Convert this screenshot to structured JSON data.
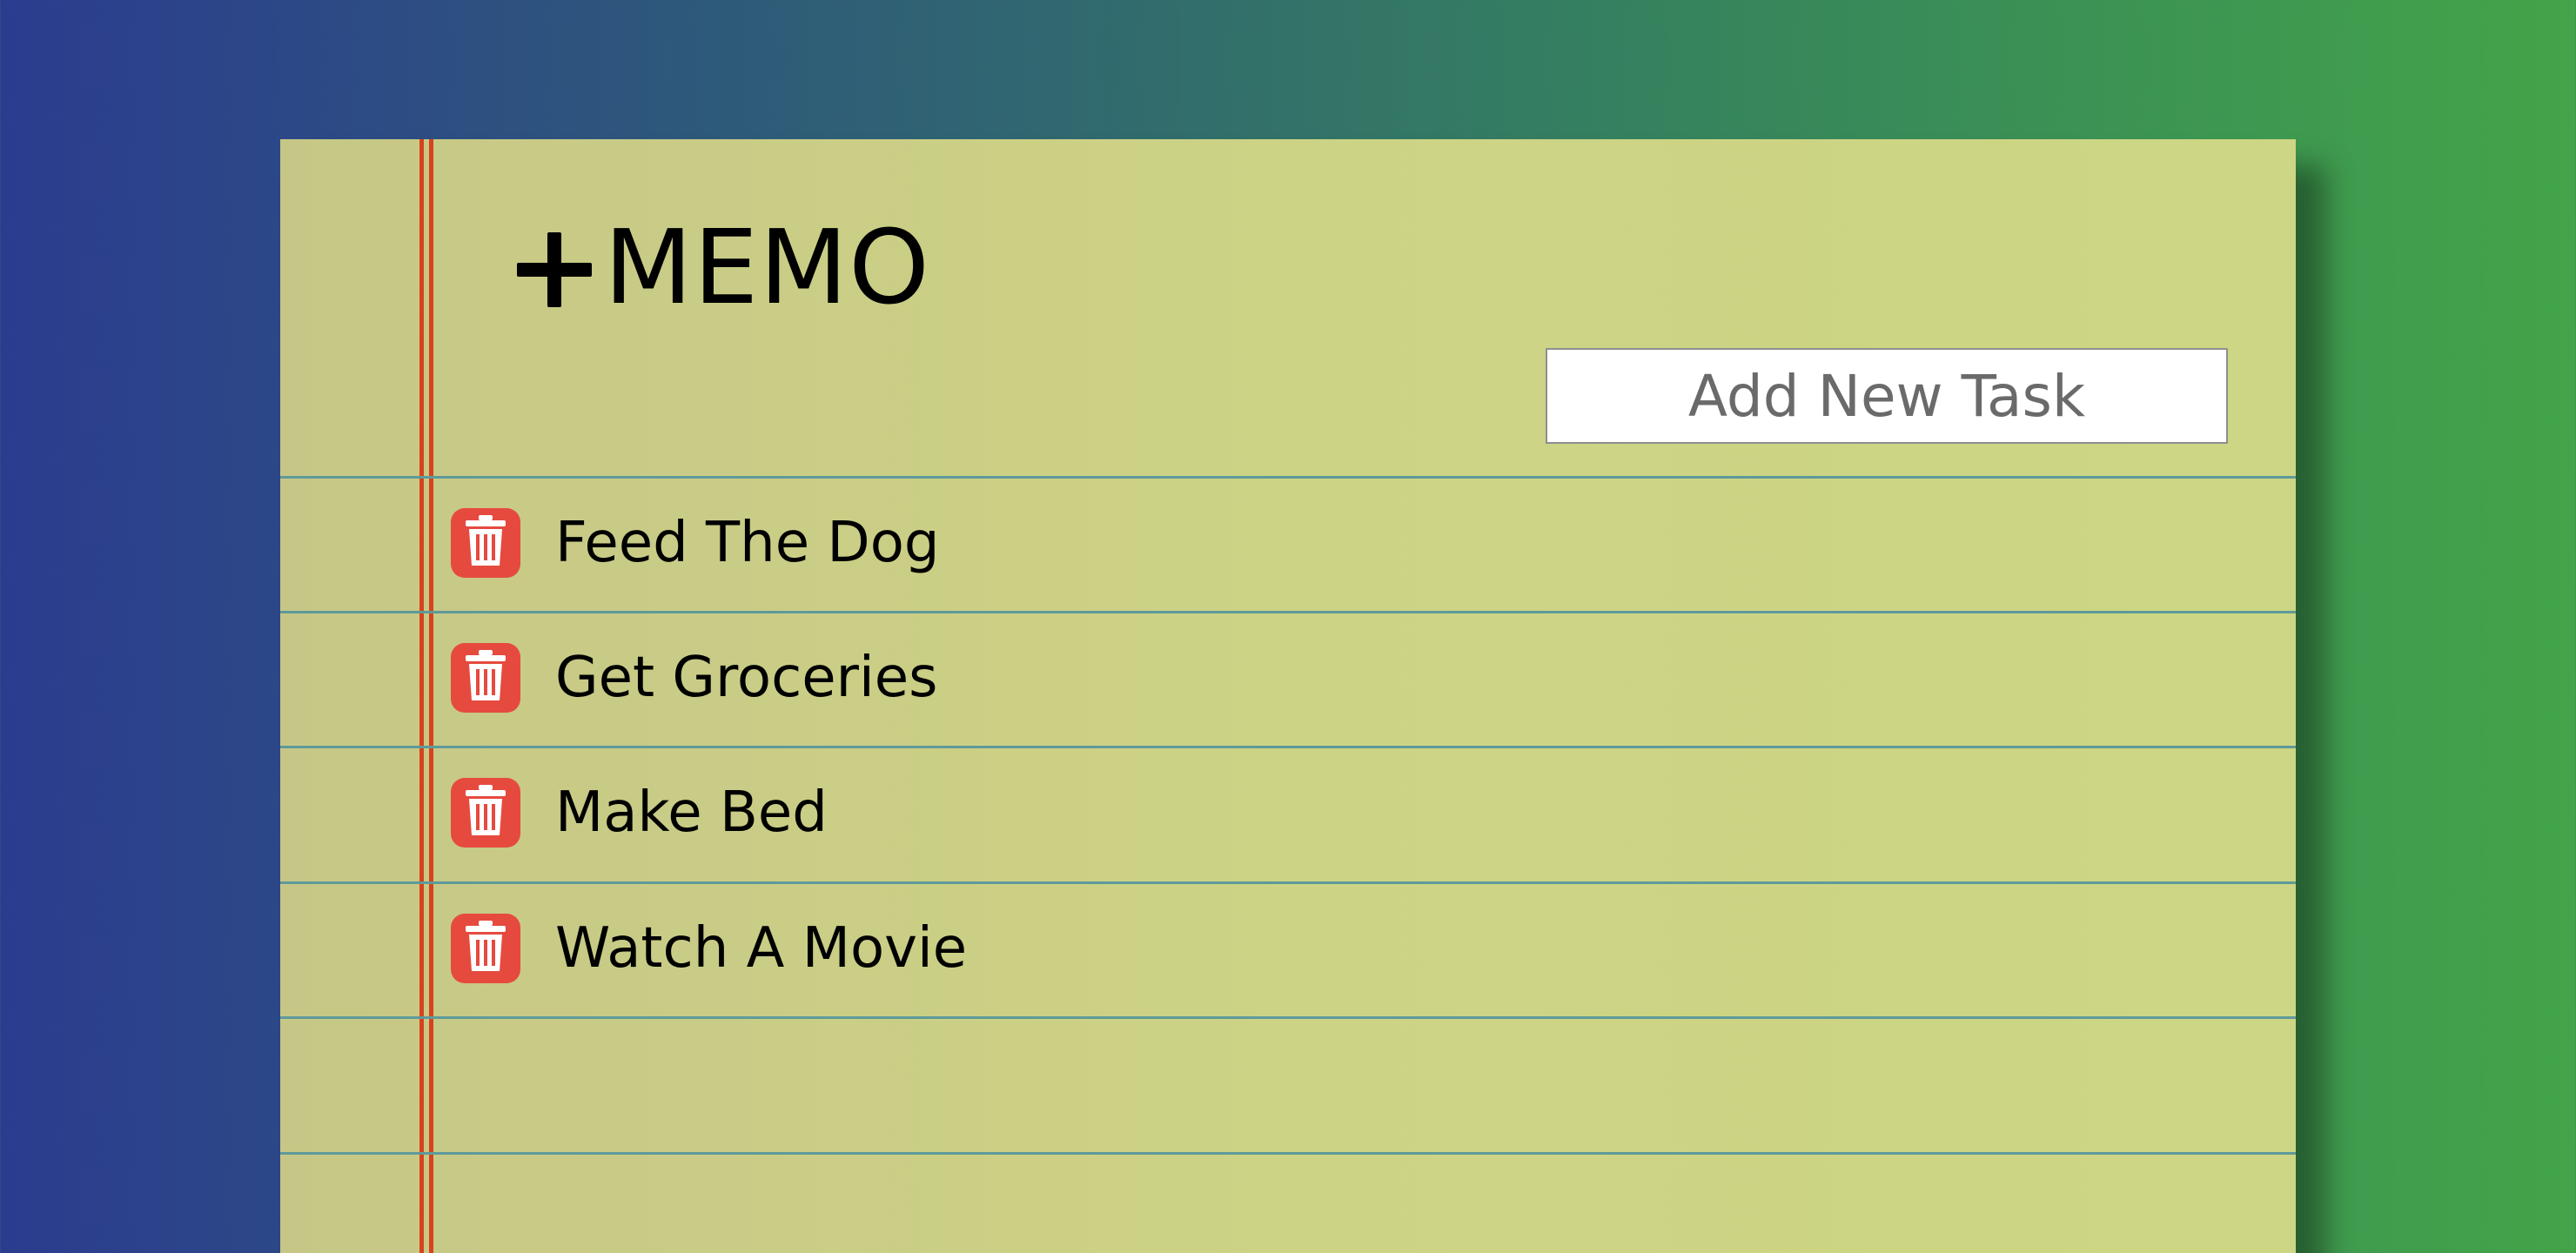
{
  "app": {
    "title": "MEMO",
    "input_placeholder": "Add New Task"
  },
  "tasks": [
    {
      "label": "Feed The Dog"
    },
    {
      "label": "Get Groceries"
    },
    {
      "label": "Make Bed"
    },
    {
      "label": "Watch A Movie"
    }
  ],
  "colors": {
    "background_gradient": [
      "#2b3c8f",
      "#43a449"
    ],
    "paper": "#cbd085",
    "margin_line": "#d9421e",
    "rule_line": "#5e9a9a",
    "delete_button": "#e64a3f"
  },
  "icons": {
    "add": "plus-icon",
    "delete": "trash-icon"
  }
}
